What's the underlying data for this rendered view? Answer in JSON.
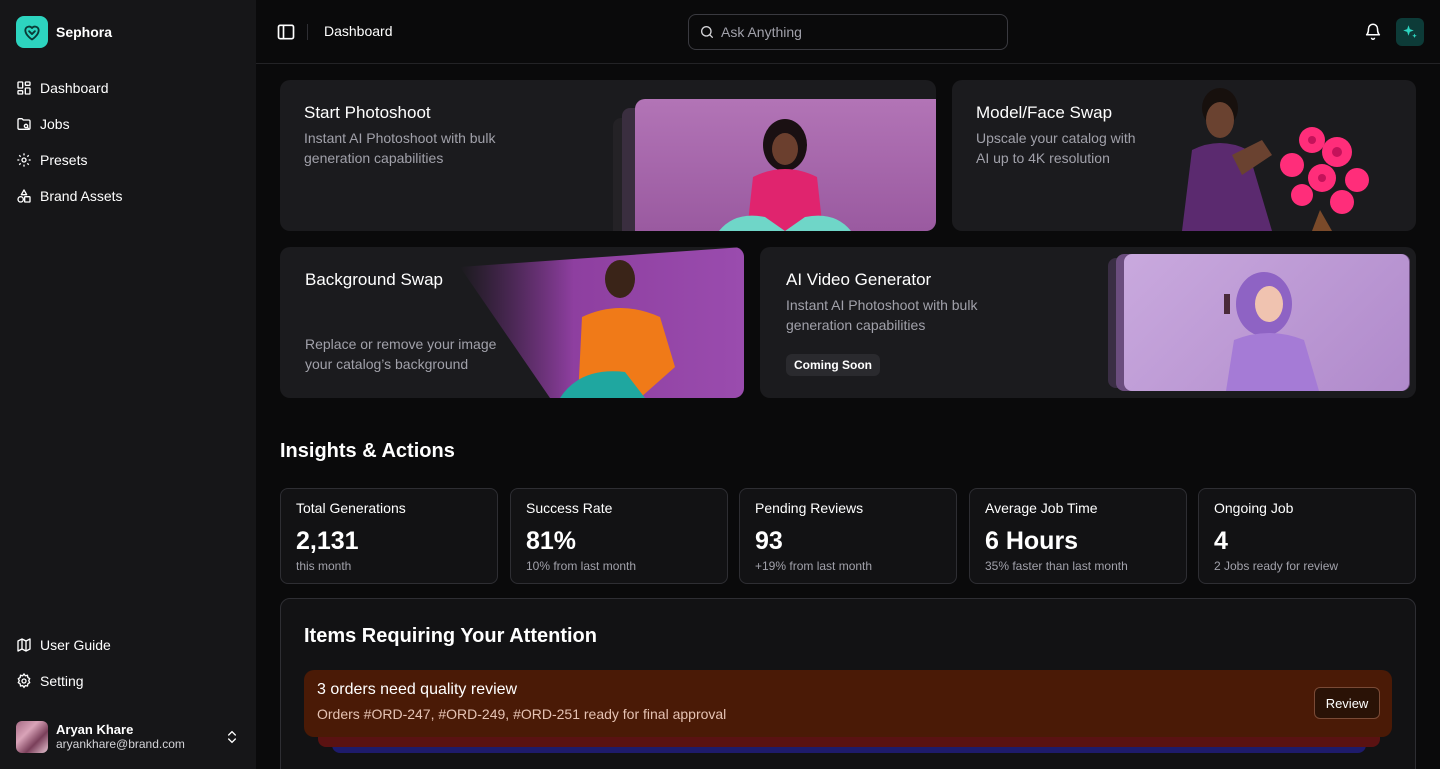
{
  "brand": {
    "name": "Sephora",
    "accent": "#2dd4bf"
  },
  "sidebar": {
    "items": [
      {
        "label": "Dashboard",
        "icon": "dashboard-icon"
      },
      {
        "label": "Jobs",
        "icon": "folder-icon"
      },
      {
        "label": "Presets",
        "icon": "gear-icon"
      },
      {
        "label": "Brand Assets",
        "icon": "shapes-icon"
      }
    ],
    "bottom_items": [
      {
        "label": "User Guide",
        "icon": "map-icon"
      },
      {
        "label": "Setting",
        "icon": "settings-icon"
      }
    ],
    "user": {
      "name": "Aryan Khare",
      "email": "aryankhare@brand.com"
    }
  },
  "header": {
    "breadcrumb": "Dashboard",
    "search_placeholder": "Ask Anything"
  },
  "features": [
    {
      "title": "Start Photoshoot",
      "desc_line1": "Instant AI Photoshoot with bulk",
      "desc_line2": "generation capabilities"
    },
    {
      "title": "Model/Face Swap",
      "desc_line1": "Upscale your catalog with",
      "desc_line2": "AI up to 4K resolution"
    },
    {
      "title": "Background Swap",
      "desc_line1": "Replace or remove your image",
      "desc_line2": "your catalog’s background"
    },
    {
      "title": "AI Video Generator",
      "desc_line1": "Instant AI Photoshoot with bulk",
      "desc_line2": "generation capabilities",
      "badge": "Coming Soon"
    }
  ],
  "insights": {
    "title": "Insights & Actions",
    "stats": [
      {
        "label": "Total Generations",
        "value": "2,131",
        "sub": "this month"
      },
      {
        "label": "Success Rate",
        "value": "81%",
        "sub": "10% from last month"
      },
      {
        "label": "Pending Reviews",
        "value": "93",
        "sub": "+19% from last month"
      },
      {
        "label": "Average Job Time",
        "value": "6 Hours",
        "sub": "35% faster than last month"
      },
      {
        "label": "Ongoing Job",
        "value": "4",
        "sub": "2 Jobs ready for review"
      }
    ]
  },
  "attention": {
    "title": "Items Requiring Your Attention",
    "alert_title": "3 orders need quality review",
    "alert_desc": "Orders #ORD-247, #ORD-249, #ORD-251 ready for final approval",
    "review_label": "Review"
  }
}
